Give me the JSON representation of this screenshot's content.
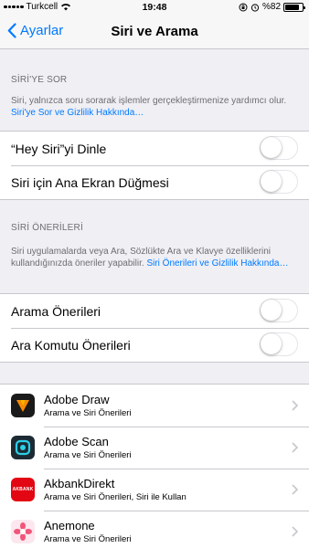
{
  "status_bar": {
    "carrier": "Turkcell",
    "time": "19:48",
    "battery_percent": "%82",
    "battery_level": 0.82
  },
  "nav": {
    "back_label": "Ayarlar",
    "title": "Siri ve Arama"
  },
  "ask_siri": {
    "header": "SİRİ'YE SOR",
    "footer_text": "Siri, yalnızca soru sorarak işlemler gerçekleştirmenize yardımcı olur. ",
    "footer_link": "Siri'ye Sor ve Gizlilik Hakkında…",
    "rows": [
      {
        "label": "“Hey Siri”yi Dinle",
        "on": false
      },
      {
        "label": "Siri için Ana Ekran Düğmesi",
        "on": false
      }
    ]
  },
  "siri_suggestions": {
    "header": "SİRİ ÖNERİLERİ",
    "footer_text": "Siri uygulamalarda veya Ara, Sözlükte Ara ve Klavye özelliklerini kullandığınızda öneriler yapabilir. ",
    "footer_link": "Siri Önerileri ve Gizlilik Hakkında…",
    "rows": [
      {
        "label": "Arama Önerileri",
        "on": false
      },
      {
        "label": "Ara Komutu Önerileri",
        "on": false
      }
    ]
  },
  "apps": [
    {
      "name": "Adobe Draw",
      "subtitle": "Arama ve Siri Önerileri",
      "icon": "adobe-draw-icon"
    },
    {
      "name": "Adobe Scan",
      "subtitle": "Arama ve Siri Önerileri",
      "icon": "adobe-scan-icon"
    },
    {
      "name": "AkbankDirekt",
      "subtitle": "Arama ve Siri Önerileri, Siri ile Kullan",
      "icon": "akbank-icon",
      "icon_text": "AKBANK"
    },
    {
      "name": "Anemone",
      "subtitle": "Arama ve Siri Önerileri",
      "icon": "anemone-icon"
    }
  ],
  "colors": {
    "accent": "#007aff",
    "background": "#efeff4"
  }
}
